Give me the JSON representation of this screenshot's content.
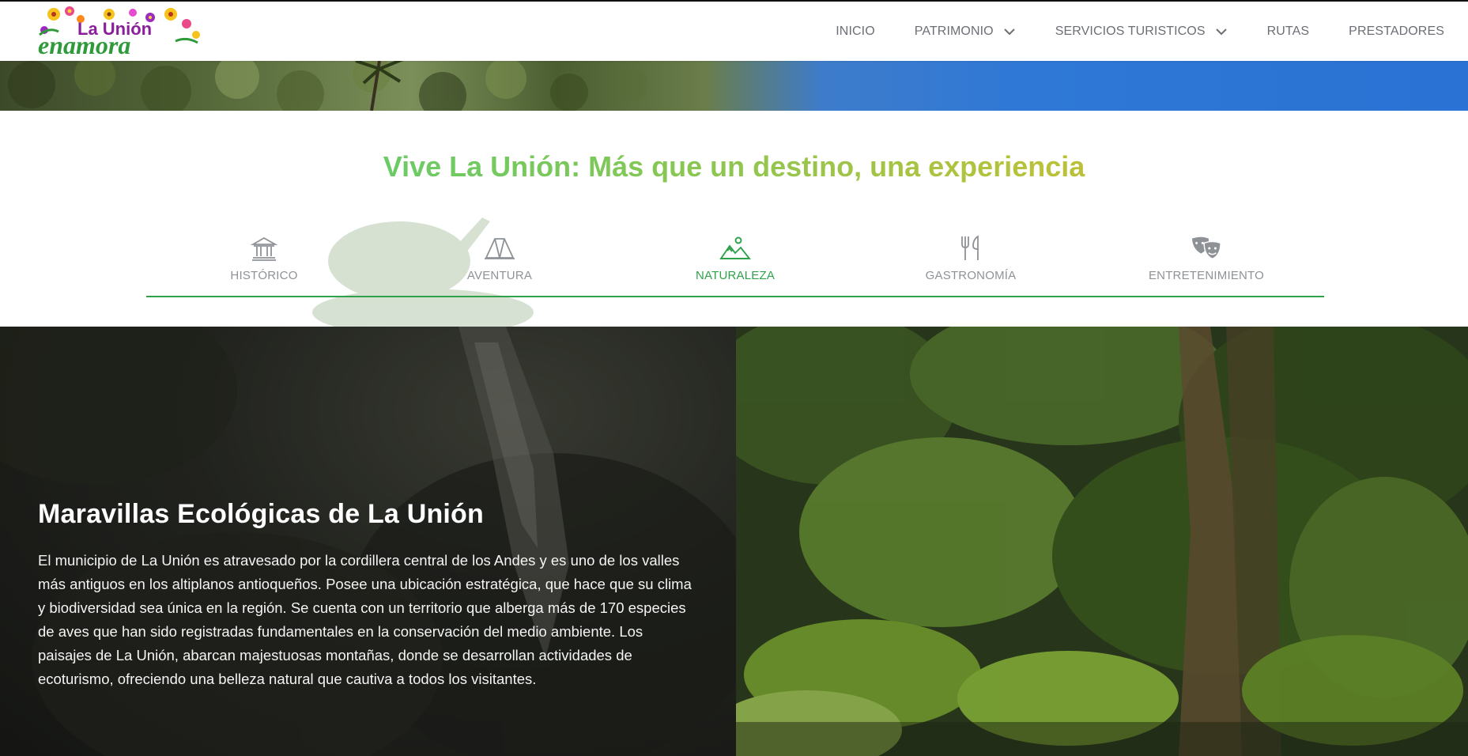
{
  "brand": {
    "logo_text_line1": "La Unión",
    "logo_text_line2": "enamora"
  },
  "nav": {
    "items": [
      {
        "label": "INICIO",
        "has_dropdown": false
      },
      {
        "label": "PATRIMONIO",
        "has_dropdown": true
      },
      {
        "label": "SERVICIOS TURISTICOS",
        "has_dropdown": true
      },
      {
        "label": "RUTAS",
        "has_dropdown": false
      },
      {
        "label": "PRESTADORES",
        "has_dropdown": false
      }
    ]
  },
  "section": {
    "title": "Vive La Unión: Más que un destino, una experiencia"
  },
  "tabs": [
    {
      "label": "HISTÓRICO",
      "icon": "museum-icon",
      "active": false
    },
    {
      "label": "AVENTURA",
      "icon": "tent-icon",
      "active": false
    },
    {
      "label": "NATURALEZA",
      "icon": "mountain-icon",
      "active": true
    },
    {
      "label": "GASTRONOMÍA",
      "icon": "fork-knife-icon",
      "active": false
    },
    {
      "label": "ENTRETENIMIENTO",
      "icon": "theater-masks-icon",
      "active": false
    }
  ],
  "content": {
    "heading": "Maravillas Ecológicas de La Unión",
    "body": "El municipio de La Unión es atravesado por la cordillera central de los Andes y es uno de los valles más antiguos en los altiplanos antioqueños. Posee una ubicación estratégica, que hace que su clima y biodiversidad sea única en la región. Se cuenta con un territorio que alberga más de 170 especies de aves que han sido registradas fundamentales en la conservación del medio ambiente. Los paisajes de La Unión, abarcan majestuosas montañas, donde se desarrollan actividades de ecoturismo, ofreciendo una belleza natural que cautiva a todos los visitantes."
  },
  "colors": {
    "accent_green": "#2ea14a",
    "nav_text": "#6b6f75",
    "tab_inactive": "#8e9297"
  }
}
